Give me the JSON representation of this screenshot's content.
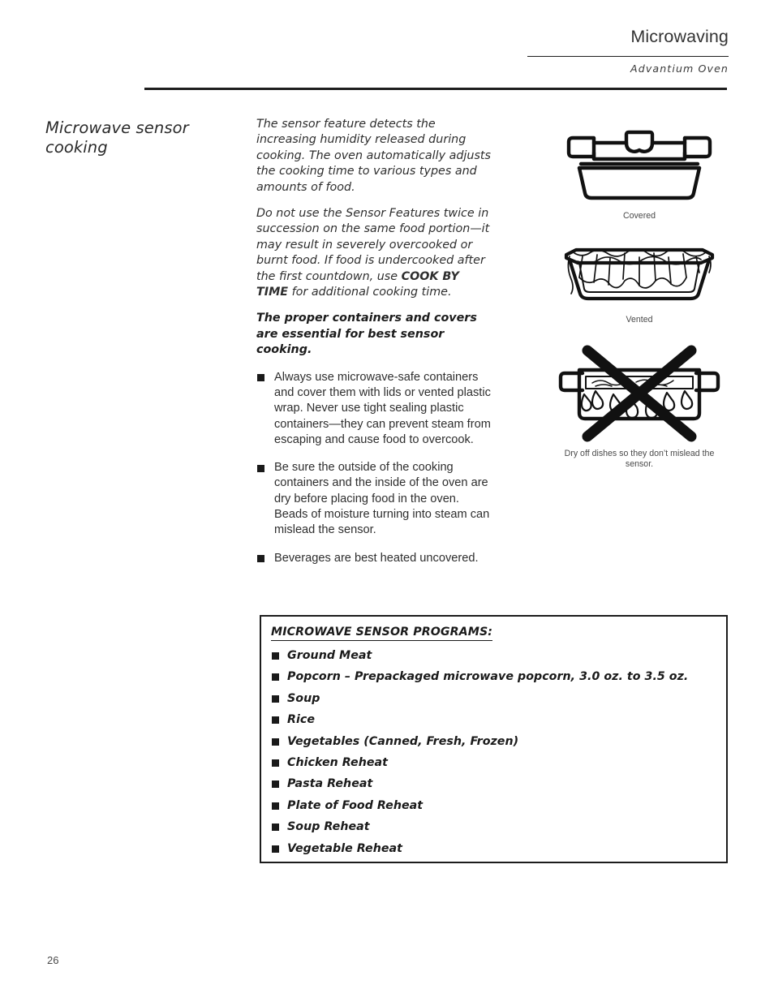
{
  "header": {
    "title": "Microwaving",
    "subtitle": "Advantium Oven"
  },
  "section": {
    "heading": "Microwave sensor cooking"
  },
  "body": {
    "paragraph_1": "The sensor feature detects the increasing humidity released during cooking. The oven automatically adjusts the cooking time to various types and amounts of food.",
    "paragraph_2_part_1": "Do not use the Sensor Features twice in succession on the same food portion—it may result in severely overcooked or burnt food. If food is undercooked after the first countdown, use ",
    "paragraph_2_emphasis": "COOK BY TIME",
    "paragraph_2_part_2": " for additional cooking time.",
    "lead_bold": "The proper containers and covers are essential for best sensor cooking.",
    "bullets": [
      "Always use microwave-safe containers and cover them with lids or vented plastic wrap. Never use tight sealing plastic containers—they can prevent steam from escaping and cause food to overcook.",
      "Be sure the outside of the cooking containers and the inside of the oven are dry before placing food in the oven. Beads of moisture turning into steam can mislead the sensor.",
      "Beverages are best heated uncovered."
    ]
  },
  "figures": [
    {
      "name": "covered-dish-illustration",
      "caption": "Covered"
    },
    {
      "name": "vented-dish-illustration",
      "caption": "Vented"
    },
    {
      "name": "wet-dish-prohibited-illustration",
      "caption": "Dry off dishes so they don’t mislead the sensor."
    }
  ],
  "programs_box": {
    "title": "MICROWAVE SENSOR PROGRAMS:",
    "items": [
      "Ground Meat",
      "Popcorn – Prepackaged microwave popcorn, 3.0 oz. to 3.5 oz.",
      "Soup",
      "Rice",
      "Vegetables (Canned, Fresh, Frozen)",
      "Chicken Reheat",
      "Pasta Reheat",
      "Plate of Food Reheat",
      "Soup Reheat",
      "Vegetable Reheat"
    ]
  },
  "footer": {
    "page_number": "26"
  },
  "colors": {
    "ink": "#1c1c1c",
    "body_text": "#2e2e2e",
    "caption": "#4a4a4a",
    "page_background": "#ffffff"
  }
}
